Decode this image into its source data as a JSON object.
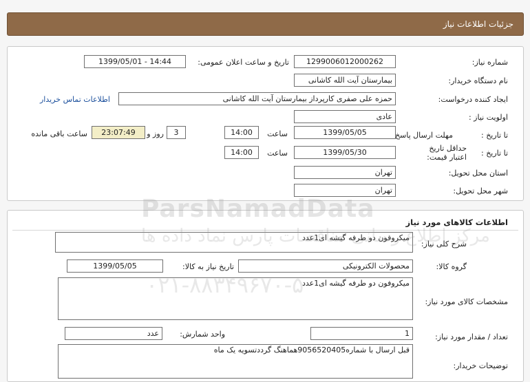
{
  "header": {
    "title": "جزئیات اطلاعات نیاز"
  },
  "info": {
    "need_number_label": "شماره نیاز:",
    "need_number": "1299006012000262",
    "announce_label": "تاریخ و ساعت اعلان عمومی:",
    "announce_value": "1399/05/01 - 14:44",
    "buyer_org_label": "نام دستگاه خریدار:",
    "buyer_org": "بیمارستان آیت الله کاشانی",
    "requester_label": "ایجاد کننده درخواست:",
    "requester": "حمزه علی صفری کارپرداز بیمارستان آیت الله کاشانی",
    "contact_link": "اطلاعات تماس خریدار",
    "priority_label": "اولویت نیاز :",
    "priority": "عادی",
    "send_deadline_label": "مهلت ارسال پاسخ:",
    "to_date_label": "تا تاریخ :",
    "send_date": "1399/05/05",
    "time_label": "ساعت",
    "send_time": "14:00",
    "days": "3",
    "days_label": "روز و",
    "remaining_time": "23:07:49",
    "remaining_label": "ساعت باقی مانده",
    "validity_label": "حداقل تاریخ اعتبار قیمت:",
    "validity_to_label": "تا تاریخ :",
    "validity_date": "1399/05/30",
    "validity_time_label": "ساعت",
    "validity_time": "14:00",
    "province_label": "استان محل تحویل:",
    "province": "تهران",
    "city_label": "شهر محل تحویل:",
    "city": "تهران"
  },
  "goods": {
    "section_title": "اطلاعات کالاهای مورد نیاز",
    "general_desc_label": "شرح کلی نیاز:",
    "general_desc": "میکروفون دو طرفه گیشه ای1عدد",
    "group_label": "گروه کالا:",
    "group": "محصولات الکترونیکی",
    "need_date_label": "تاریخ نیاز به کالا:",
    "need_date": "1399/05/05",
    "specs_label": "مشخصات کالای مورد نیاز:",
    "specs": "میکروفون دو طرفه گیشه ای1عدد",
    "qty_label": "تعداد / مقدار مورد نیاز:",
    "qty": "1",
    "unit_label": "واحد شمارش:",
    "unit": "عدد",
    "buyer_notes_label": "توضیحات خریدار:",
    "buyer_notes": "قبل ارسال با شماره9056520405هماهنگ گرددتسویه یک ماه"
  },
  "watermark": {
    "brand": "ParsNamadData",
    "tagline": "مرکز اطلاع رسانی مناقصات پارس نماد داده ها",
    "phone": "۰۲۱-۸۸۳۴۹۶۷۰-۵"
  },
  "colors": {
    "header_bg": "#8f6a48",
    "highlight_bg": "#f3eec7",
    "link": "#1b4f9c"
  }
}
